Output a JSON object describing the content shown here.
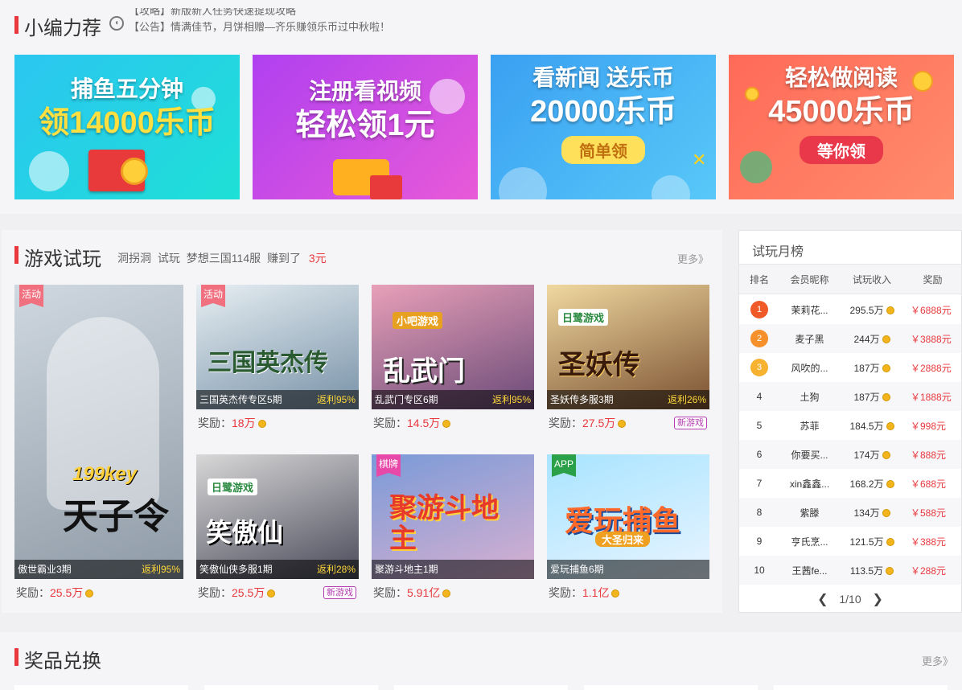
{
  "recommend": {
    "title": "小编力荐",
    "notices": [
      "【攻略】新版新人任务快速提现攻略",
      "【公告】情满佳节，月饼相赠—齐乐赚领乐币过中秋啦！"
    ]
  },
  "banners": [
    {
      "line1": "捕鱼五分钟",
      "line2": "领14000乐币",
      "colors": [
        "#2bc6f0",
        "#1ee0d6"
      ]
    },
    {
      "line1": "注册看视频",
      "line2": "轻松领1元",
      "colors": [
        "#b040f0",
        "#e85ad8"
      ]
    },
    {
      "line1": "看新闻 送乐币",
      "line2": "20000乐币",
      "pill": "简单领",
      "colors": [
        "#3aa0f2",
        "#58c8f8"
      ]
    },
    {
      "line1": "轻松做阅读",
      "line2": "45000乐币",
      "pill": "等你领",
      "colors": [
        "#ff6a58",
        "#ff8c6c"
      ]
    }
  ],
  "trial": {
    "title": "游戏试玩",
    "ticker": {
      "user": "洞拐洞",
      "action": "试玩",
      "game": "梦想三国114服",
      "earned": "赚到了",
      "amount": "3元"
    },
    "more": "更多》",
    "reward_label": "奖励：",
    "games": [
      {
        "name": "傲世霸业3期",
        "rebate": "返利95%",
        "reward": "25.5万",
        "tag": "活动",
        "logo": "天子令",
        "brand": "199key",
        "colors": [
          "#cfd8e0",
          "#8e9aa6"
        ]
      },
      {
        "name": "三国英杰传专区5期",
        "rebate": "返利95%",
        "reward": "18万",
        "tag": "活动",
        "logo": "三国英杰传",
        "colors": [
          "#e6eef2",
          "#7892a8"
        ]
      },
      {
        "name": "乱武门专区6期",
        "rebate": "返利95%",
        "reward": "14.5万",
        "logo": "乱武门",
        "brand": "小吧游戏",
        "colors": [
          "#e8a0b8",
          "#6a4a78"
        ]
      },
      {
        "name": "圣妖传多服3期",
        "rebate": "返利26%",
        "reward": "27.5万",
        "badge": "新游戏",
        "logo": "圣妖传",
        "brand": "日鹭游戏",
        "colors": [
          "#f0d8a0",
          "#7a5030"
        ]
      },
      {
        "name": "笑傲仙侠多服1期",
        "rebate": "返利28%",
        "reward": "25.5万",
        "badge": "新游戏",
        "logo": "笑傲仙",
        "brand": "日鹭游戏",
        "colors": [
          "#d8d8d8",
          "#4a4a5a"
        ]
      },
      {
        "name": "聚游斗地主1期",
        "reward": "5.91亿",
        "tag": "棋牌",
        "logo": "聚游斗地主",
        "colors": [
          "#7a9ad8",
          "#d8b0d0"
        ]
      },
      {
        "name": "爱玩捕鱼6期",
        "reward": "1.1亿",
        "tag": "APP",
        "logo": "爱玩捕鱼",
        "sub": "大圣归来",
        "colors": [
          "#a8e4ff",
          "#e8f4ff"
        ]
      }
    ]
  },
  "ranking": {
    "title": "试玩月榜",
    "headers": [
      "排名",
      "会员昵称",
      "试玩收入",
      "奖励"
    ],
    "rows": [
      {
        "rank": "1",
        "nick": "茉莉花...",
        "income": "295.5万",
        "prize": "￥6888元"
      },
      {
        "rank": "2",
        "nick": "麦子黑",
        "income": "244万",
        "prize": "￥3888元"
      },
      {
        "rank": "3",
        "nick": "风吹的...",
        "income": "187万",
        "prize": "￥2888元"
      },
      {
        "rank": "4",
        "nick": "土狗",
        "income": "187万",
        "prize": "￥1888元"
      },
      {
        "rank": "5",
        "nick": "苏菲",
        "income": "184.5万",
        "prize": "￥998元"
      },
      {
        "rank": "6",
        "nick": "你要买...",
        "income": "174万",
        "prize": "￥888元"
      },
      {
        "rank": "7",
        "nick": "xin鑫鑫...",
        "income": "168.2万",
        "prize": "￥688元"
      },
      {
        "rank": "8",
        "nick": "紫滕",
        "income": "134万",
        "prize": "￥588元"
      },
      {
        "rank": "9",
        "nick": "亨氏烹...",
        "income": "121.5万",
        "prize": "￥388元"
      },
      {
        "rank": "10",
        "nick": "王茜fe...",
        "income": "113.5万",
        "prize": "￥288元"
      }
    ],
    "page": "1/10",
    "medal_colors": [
      "#f05a28",
      "#f5902a",
      "#f7b230"
    ]
  },
  "exchange": {
    "title": "奖品兑换",
    "more": "更多》"
  }
}
